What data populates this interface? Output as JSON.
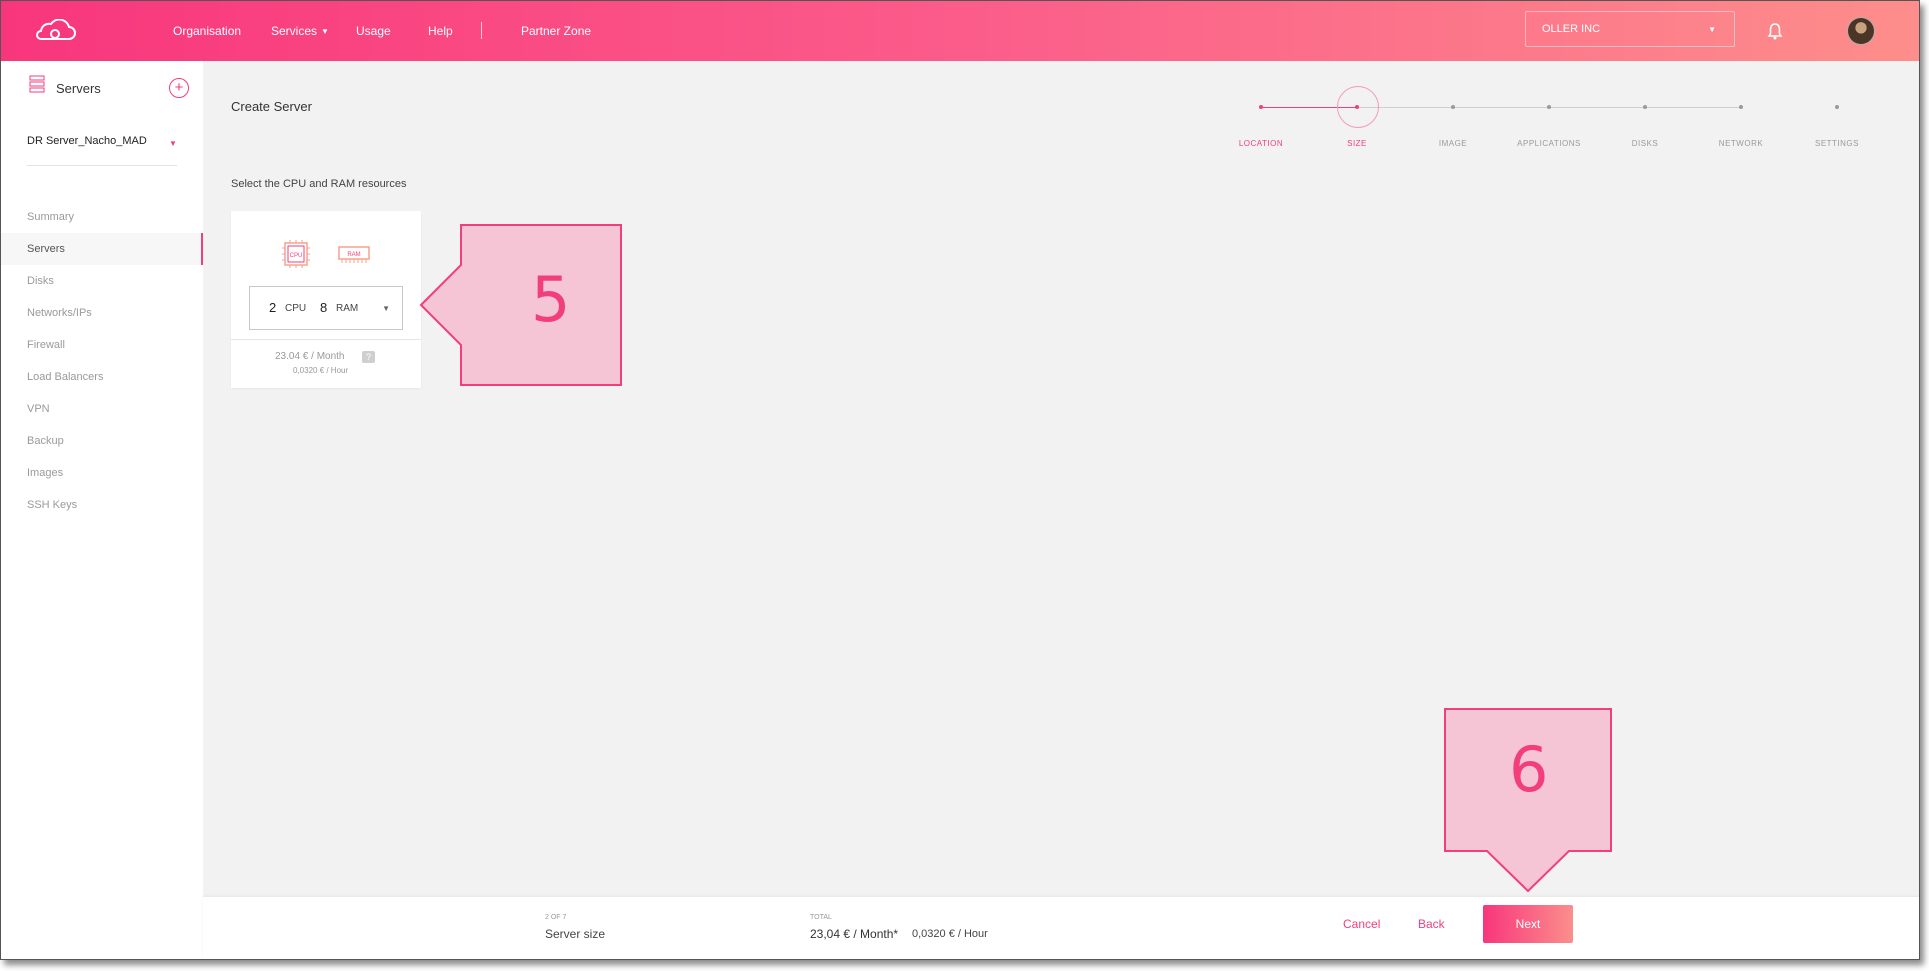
{
  "topbar": {
    "nav": {
      "organisation": "Organisation",
      "services": "Services",
      "usage": "Usage",
      "help": "Help",
      "partner_zone": "Partner Zone"
    },
    "org_selector": "OLLER INC"
  },
  "sidebar": {
    "title": "Servers",
    "project": "DR Server_Nacho_MAD",
    "items": [
      {
        "label": "Summary"
      },
      {
        "label": "Servers",
        "active": true
      },
      {
        "label": "Disks"
      },
      {
        "label": "Networks/IPs"
      },
      {
        "label": "Firewall"
      },
      {
        "label": "Load Balancers"
      },
      {
        "label": "VPN"
      },
      {
        "label": "Backup"
      },
      {
        "label": "Images"
      },
      {
        "label": "SSH Keys"
      }
    ]
  },
  "main": {
    "title": "Create Server",
    "steps": [
      {
        "label": "LOCATION",
        "state": "done"
      },
      {
        "label": "SIZE",
        "state": "current"
      },
      {
        "label": "IMAGE",
        "state": "todo"
      },
      {
        "label": "APPLICATIONS",
        "state": "todo"
      },
      {
        "label": "DISKS",
        "state": "todo"
      },
      {
        "label": "NETWORK",
        "state": "todo"
      },
      {
        "label": "SETTINGS",
        "state": "todo"
      }
    ],
    "section_label": "Select the CPU and RAM resources",
    "size_card": {
      "cpu_icon_text": "CPU",
      "ram_icon_text": "RAM",
      "cpu_value": "2",
      "cpu_unit": "CPU",
      "ram_value": "8",
      "ram_unit": "RAM",
      "price_month": "23.04 € / Month",
      "help": "?",
      "price_hour": "0,0320 € / Hour"
    }
  },
  "annotations": {
    "callout_5": "5",
    "callout_6": "6"
  },
  "footer": {
    "step_counter": "2 OF 7",
    "step_name": "Server size",
    "total_label": "TOTAL",
    "total_month": "23,04 € / Month*",
    "total_hour": "0,0320 € / Hour",
    "cancel": "Cancel",
    "back": "Back",
    "next": "Next"
  },
  "colors": {
    "accent": "#f23e7d",
    "header_gradient_start": "#f8367c",
    "header_gradient_end": "#fd8e8b",
    "callout_fill": "#f5c5d5"
  }
}
